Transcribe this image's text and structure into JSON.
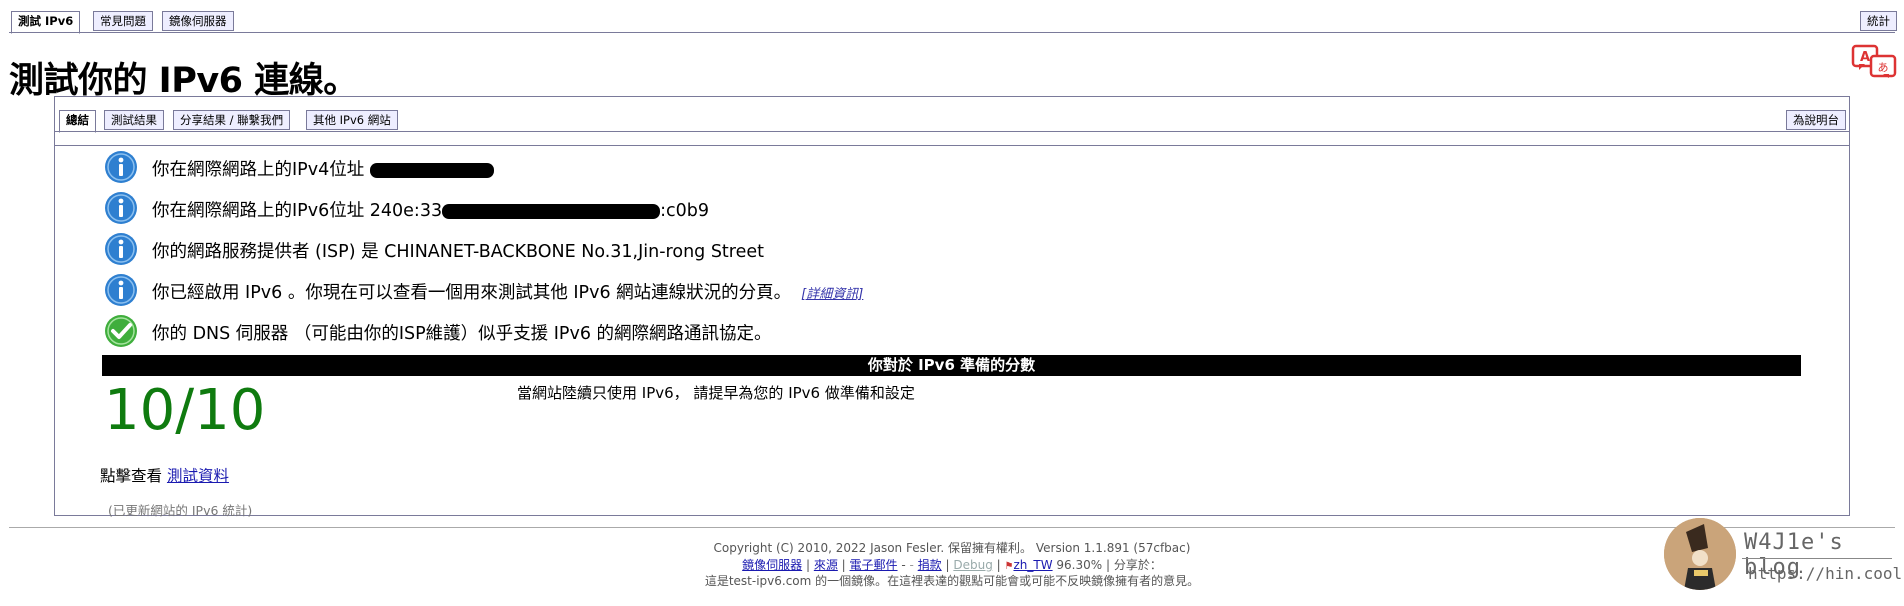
{
  "top_tabs": [
    {
      "label": "測試 IPv6",
      "active": true
    },
    {
      "label": "常見問題",
      "active": false
    },
    {
      "label": "鏡像伺服器",
      "active": false
    }
  ],
  "stats_tab": "統計",
  "title": "測試你的 IPv6 連線。",
  "inner_tabs": [
    {
      "label": "總結",
      "active": true
    },
    {
      "label": "測試結果",
      "active": false
    },
    {
      "label": "分享結果 / 聯繫我們",
      "active": false
    },
    {
      "label": "其他 IPv6 網站",
      "active": false
    }
  ],
  "helpdesk_tab": "為說明台",
  "results": [
    {
      "icon": "info-icon",
      "text": "你在網際網路上的IPv4位址 ",
      "suffix": ""
    },
    {
      "icon": "info-icon",
      "text": "你在網際網路上的IPv6位址 240e:33",
      "suffix": ":c0b9"
    },
    {
      "icon": "info-icon",
      "text": "你的網路服務提供者 (ISP) 是 CHINANET-BACKBONE No.31,Jin-rong Street",
      "suffix": ""
    },
    {
      "icon": "info-icon",
      "text": "你已經啟用 IPv6 。你現在可以查看一個用來測試其他 IPv6 網站連線狀況的分頁。",
      "suffix": "",
      "link": "[詳細資訊]"
    },
    {
      "icon": "check-icon",
      "text": "你的 DNS 伺服器 （可能由你的ISP維護）似乎支援 IPv6 的網際網路通訊協定。",
      "suffix": ""
    }
  ],
  "score_header": "你對於 IPv6 準備的分數",
  "score": "10/10",
  "score_note": "當網站陸續只使用 IPv6， 請提早為您的 IPv6 做準備和設定",
  "click_prefix": "點擊查看 ",
  "click_link": "測試資料",
  "stats_note": "(已更新網站的 IPv6 統計)",
  "footer": {
    "copyright": "Copyright (C) 2010, 2022 Jason Fesler. 保留擁有權利。 Version 1.1.891 (57cfbac)",
    "links": [
      "鏡像伺服器",
      "來源",
      "電子郵件",
      "捐款",
      "Debug",
      "zh_TW"
    ],
    "locale_pct": "96.30%",
    "share": "分享於：",
    "mirror_note": "這是test-ipv6.com 的一個鏡像。在這裡表達的觀點可能會或可能不反映鏡像擁有者的意見。"
  },
  "blog": {
    "name": "W4J1e's blog",
    "url": "https://hin.cool"
  },
  "colors": {
    "score_green": "#0f7b0f",
    "info_blue": "#2e7fd0",
    "check_green": "#3fae3c"
  }
}
